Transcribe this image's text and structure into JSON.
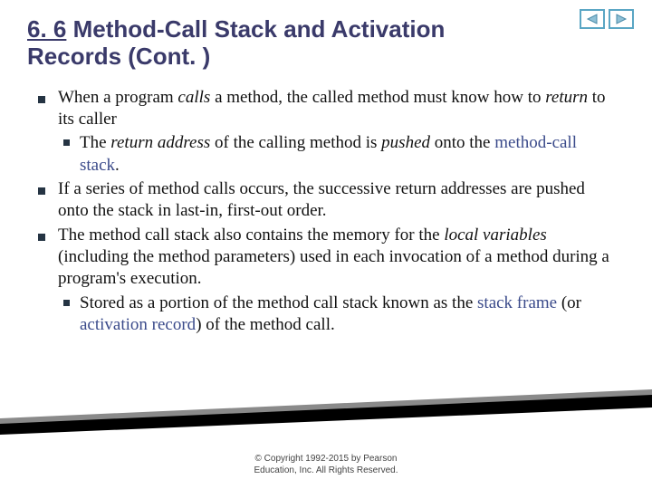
{
  "nav": {
    "prev_icon": "triangle-left",
    "next_icon": "triangle-right"
  },
  "title": {
    "section_number": "6. 6",
    "text": "Method-Call Stack and Activation Records (Cont. )"
  },
  "bullets": [
    {
      "runs": [
        {
          "t": "When a program "
        },
        {
          "t": "calls",
          "italic": true
        },
        {
          "t": " a method, the called method must know how to "
        },
        {
          "t": "return",
          "italic": true
        },
        {
          "t": " to its caller"
        }
      ],
      "sub": [
        {
          "runs": [
            {
              "t": "The "
            },
            {
              "t": "return address",
              "italic": true
            },
            {
              "t": " of the calling method is "
            },
            {
              "t": "pushed",
              "italic": true
            },
            {
              "t": " onto the "
            },
            {
              "t": "method-call stack",
              "accent": true
            },
            {
              "t": "."
            }
          ]
        }
      ]
    },
    {
      "runs": [
        {
          "t": "If a series of method calls occurs, the successive return addresses are pushed onto the stack in last-in, first-out order."
        }
      ]
    },
    {
      "runs": [
        {
          "t": "The method call stack also contains the memory for the "
        },
        {
          "t": "local variables",
          "italic": true
        },
        {
          "t": " (including the method parameters) used in each invocation of a method during a program's execution."
        }
      ],
      "sub": [
        {
          "runs": [
            {
              "t": "Stored as a portion of the method call stack known as the  "
            },
            {
              "t": "stack frame",
              "accent": true
            },
            {
              "t": " (or "
            },
            {
              "t": "activation record",
              "accent": true
            },
            {
              "t": ") of the method call."
            }
          ]
        }
      ]
    }
  ],
  "footer": {
    "line1": "© Copyright 1992-2015 by Pearson",
    "line2": "Education, Inc. All Rights Reserved."
  }
}
